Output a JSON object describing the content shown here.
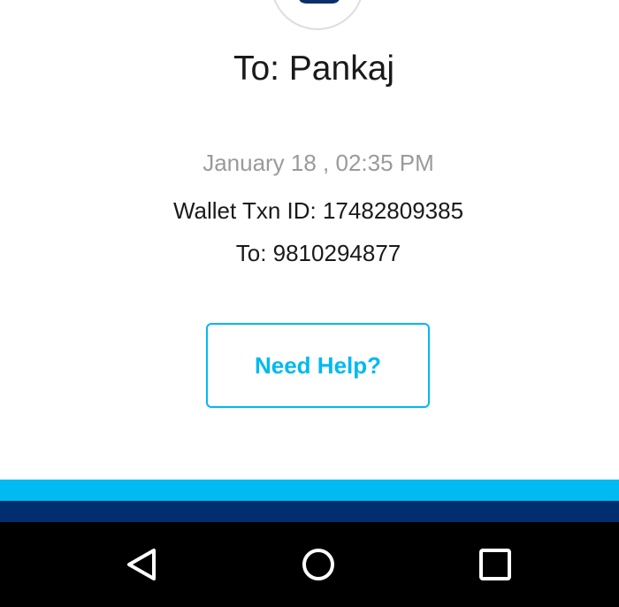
{
  "payment": {
    "recipient_title": "To: Pankaj",
    "timestamp": "January 18 , 02:35 PM",
    "txn_id": "Wallet Txn ID: 17482809385",
    "to_number": "To: 9810294877"
  },
  "actions": {
    "help_label": "Need Help?"
  },
  "colors": {
    "accent": "#00b9f1",
    "band_light": "#00baf2",
    "band_dark": "#002e6e",
    "navbar": "#000000"
  },
  "navbar": {
    "buttons": [
      "back-icon",
      "home-icon",
      "recents-icon"
    ]
  }
}
